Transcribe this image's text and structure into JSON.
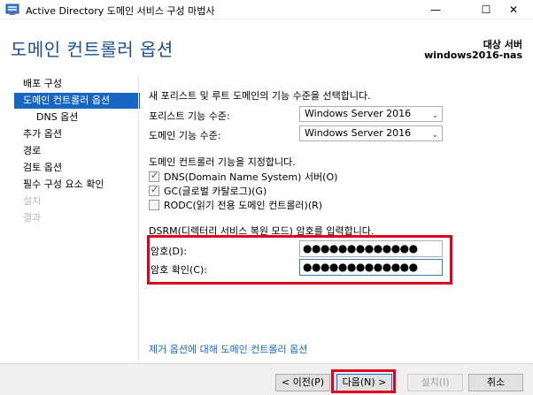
{
  "window": {
    "title": "Active Directory 도메인 서비스 구성 마법사",
    "minimize_glyph": "—",
    "maximize_glyph": "☐",
    "close_glyph": "✕"
  },
  "header": {
    "page_title": "도메인 컨트롤러 옵션",
    "target_label": "대상 서버",
    "target_value": "windows2016-nas"
  },
  "sidebar": {
    "items": [
      {
        "label": "배포 구성"
      },
      {
        "label": "도메인 컨트롤러 옵션"
      },
      {
        "label": "DNS 옵션"
      },
      {
        "label": "추가 옵션"
      },
      {
        "label": "경로"
      },
      {
        "label": "검토 옵션"
      },
      {
        "label": "필수 구성 요소 확인"
      },
      {
        "label": "설치"
      },
      {
        "label": "결과"
      }
    ]
  },
  "main": {
    "functional_level_heading": "새 포리스트 및 루트 도메인의 기능 수준을 선택합니다.",
    "forest_level_label": "포리스트 기능 수준:",
    "forest_level_value": "Windows Server 2016",
    "domain_level_label": "도메인 기능 수준:",
    "domain_level_value": "Windows Server 2016",
    "capabilities_heading": "도메인 컨트롤러 기능을 지정합니다.",
    "capabilities": [
      {
        "label": "DNS(Domain Name System) 서버(O)",
        "checked": true
      },
      {
        "label": "GC(글로벌 카탈로그)(G)",
        "checked": true
      },
      {
        "label": "RODC(읽기 전용 도메인 컨트롤러)(R)",
        "checked": false
      }
    ],
    "dsrm_heading": "DSRM(디렉터리 서비스 복원 모드) 암호를 입력합니다.",
    "password_label": "암호(D):",
    "password_value": "●●●●●●●●●●●●●",
    "confirm_label": "암호 확인(C):",
    "confirm_value": "●●●●●●●●●●●●●",
    "more_link": "제거 옵션에 대해 도메인 컨트롤러 옵션"
  },
  "footer": {
    "prev_label": "< 이전(P)",
    "next_label": "다음(N) >",
    "install_label": "설치(I)",
    "cancel_label": "취소"
  },
  "colors": {
    "accent": "#1766c2",
    "title_blue": "#1b4f8c",
    "highlight_red": "#e0001b"
  }
}
